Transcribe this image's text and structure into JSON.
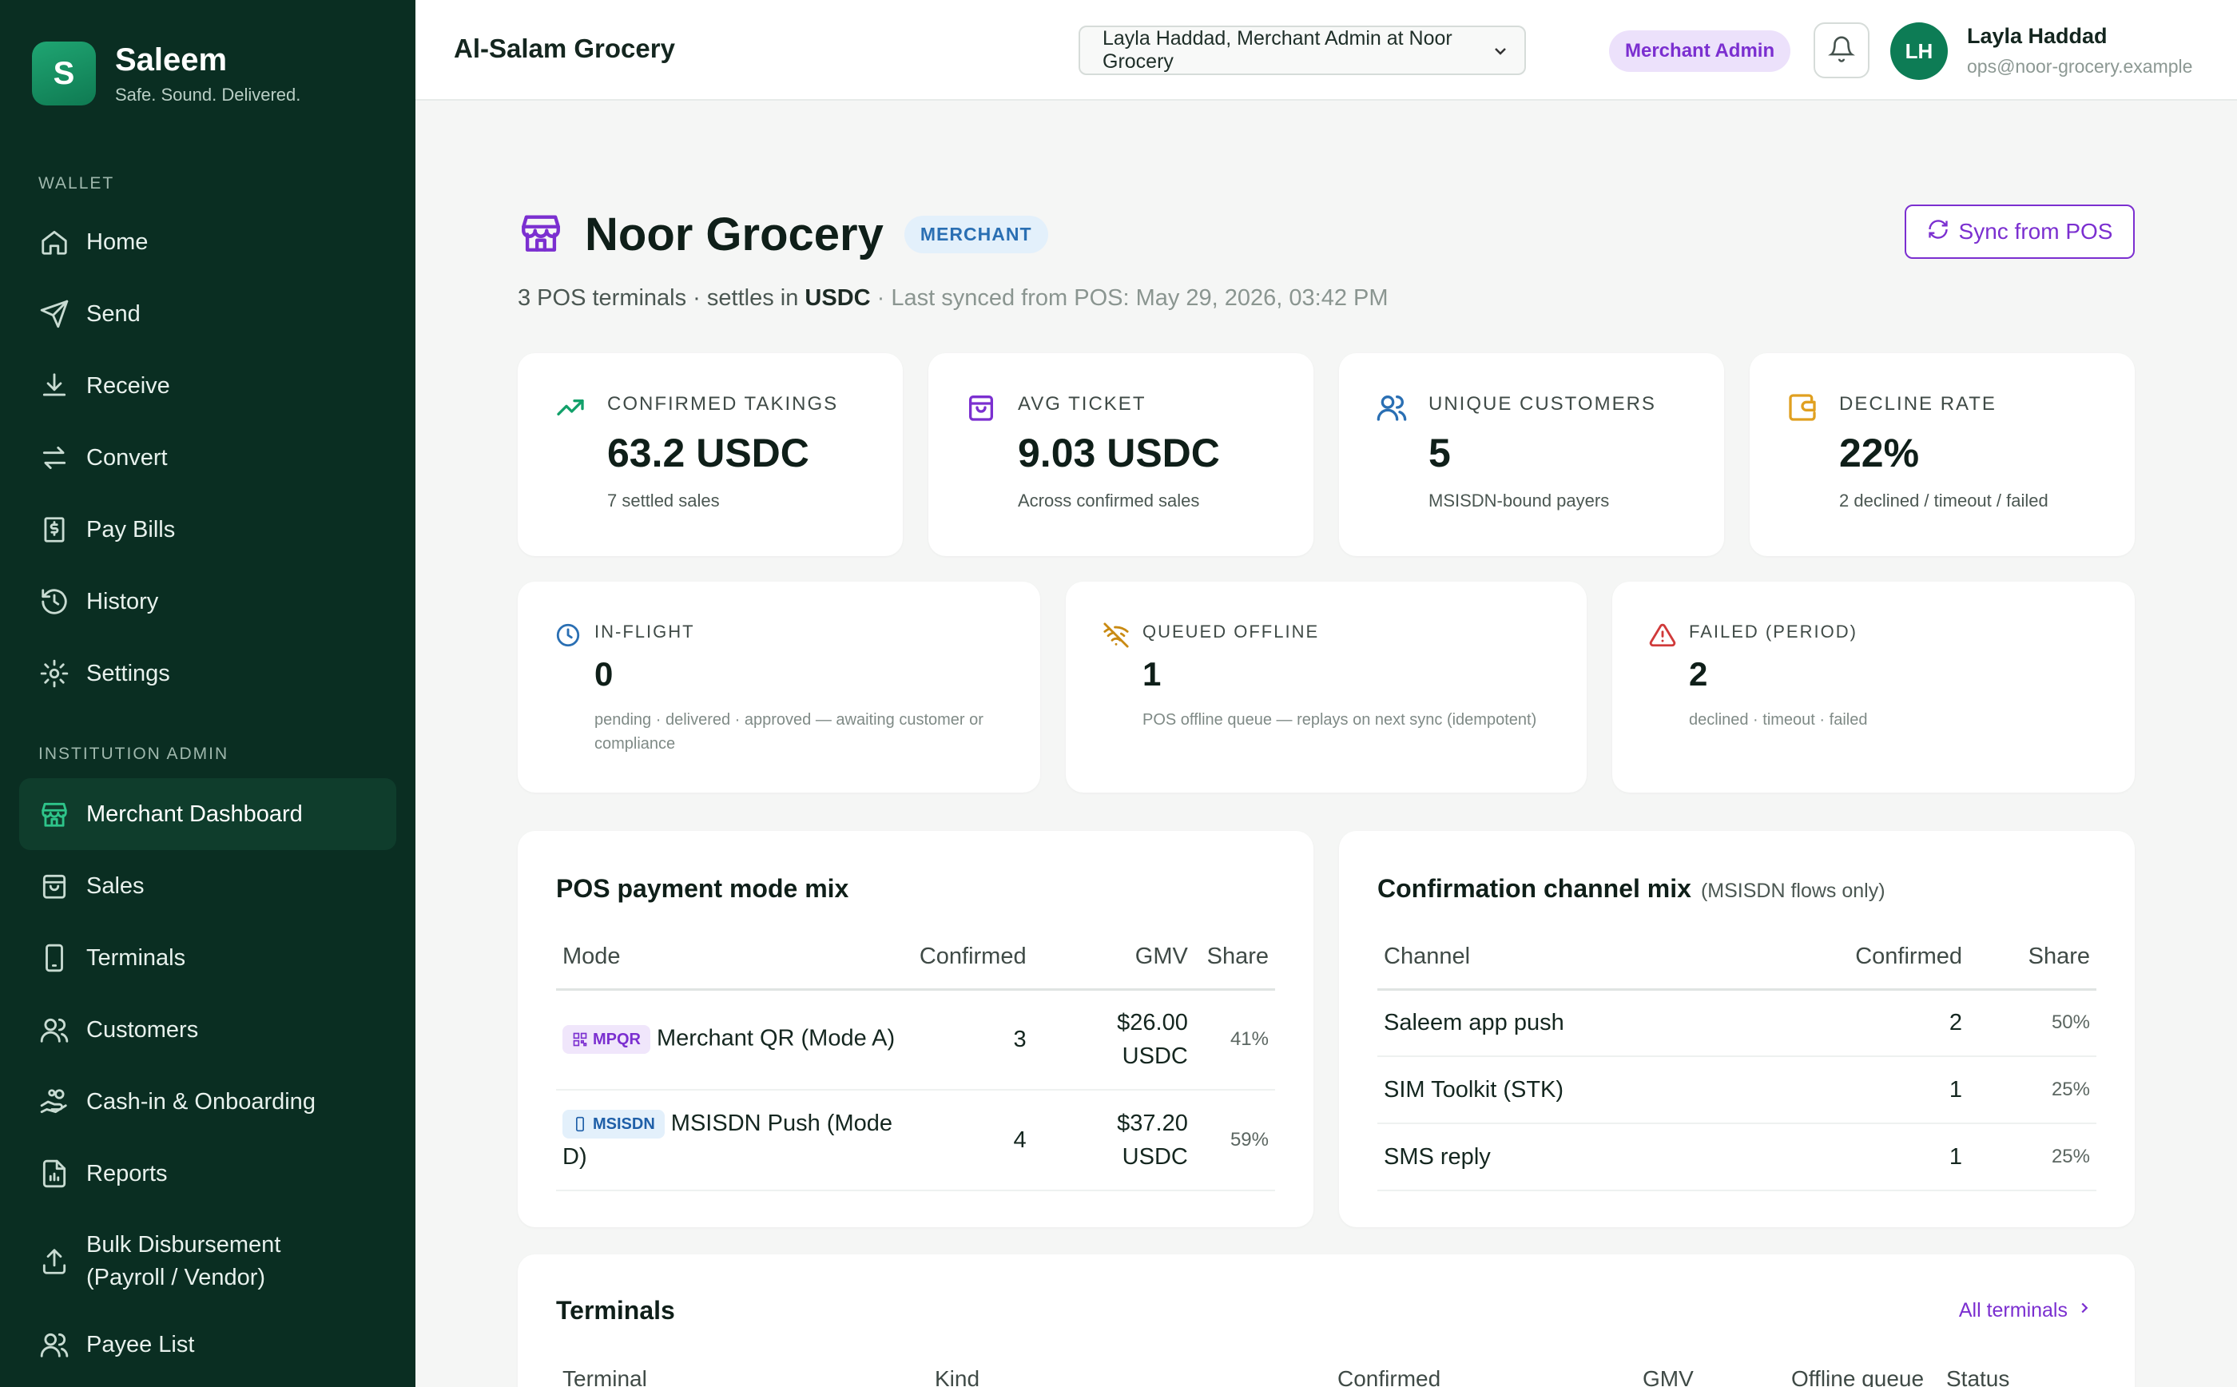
{
  "brand": {
    "initial": "S",
    "name": "Saleem",
    "tagline": "Safe. Sound. Delivered."
  },
  "sidebar": {
    "wallet_section": "WALLET",
    "wallet_items": [
      {
        "label": "Home",
        "icon": "home-icon"
      },
      {
        "label": "Send",
        "icon": "send-icon"
      },
      {
        "label": "Receive",
        "icon": "receive-icon"
      },
      {
        "label": "Convert",
        "icon": "convert-icon"
      },
      {
        "label": "Pay Bills",
        "icon": "bill-icon"
      },
      {
        "label": "History",
        "icon": "history-icon"
      },
      {
        "label": "Settings",
        "icon": "settings-icon"
      }
    ],
    "admin_section": "INSTITUTION ADMIN",
    "admin_items": [
      {
        "label": "Merchant Dashboard",
        "icon": "store-icon",
        "active": true
      },
      {
        "label": "Sales",
        "icon": "shopping-bag-icon"
      },
      {
        "label": "Terminals",
        "icon": "terminal-icon"
      },
      {
        "label": "Customers",
        "icon": "users-icon"
      },
      {
        "label": "Cash-in & Onboarding",
        "icon": "hand-coins-icon"
      },
      {
        "label": "Reports",
        "icon": "report-icon"
      },
      {
        "label": "Bulk Disbursement (Payroll / Vendor)",
        "icon": "upload-icon"
      },
      {
        "label": "Payee List",
        "icon": "payees-icon"
      }
    ]
  },
  "header": {
    "org_title": "Al-Salam Grocery",
    "role_select_value": "Layla Haddad, Merchant Admin at Noor Grocery",
    "role_pill": "Merchant Admin",
    "user_initials": "LH",
    "user_name": "Layla Haddad",
    "user_email": "ops@noor-grocery.example"
  },
  "page": {
    "title": "Noor Grocery",
    "badge": "MERCHANT",
    "sync_button": "Sync from POS",
    "sub_terminals": "3 POS terminals · settles in",
    "sub_currency": "USDC",
    "sub_synced": "· Last synced from POS: May 29, 2026, 03:42 PM"
  },
  "kpis": [
    {
      "label": "CONFIRMED TAKINGS",
      "value": "63.2 USDC",
      "sub": "7 settled sales",
      "icon": "trending-up-icon",
      "color": "#12a06a"
    },
    {
      "label": "AVG TICKET",
      "value": "9.03 USDC",
      "sub": "Across confirmed sales",
      "icon": "shopping-bag-icon",
      "color": "#7b2fd0"
    },
    {
      "label": "UNIQUE CUSTOMERS",
      "value": "5",
      "sub": "MSISDN-bound payers",
      "icon": "users-icon",
      "color": "#2a6fb3"
    },
    {
      "label": "DECLINE RATE",
      "value": "22%",
      "sub": "2 declined / timeout / failed",
      "icon": "wallet-icon",
      "color": "#e0a020"
    }
  ],
  "status_cards": [
    {
      "label": "IN-FLIGHT",
      "value": "0",
      "sub": "pending · delivered · approved — awaiting customer or compliance",
      "icon": "clock-icon",
      "color": "#2a6fb3"
    },
    {
      "label": "QUEUED OFFLINE",
      "value": "1",
      "sub": "POS offline queue — replays on next sync (idempotent)",
      "icon": "wifi-off-icon",
      "color": "#c98a12"
    },
    {
      "label": "FAILED (PERIOD)",
      "value": "2",
      "sub": "declined · timeout · failed",
      "icon": "alert-triangle-icon",
      "color": "#d03a3a"
    }
  ],
  "mode_mix": {
    "title": "POS payment mode mix",
    "headers": [
      "Mode",
      "Confirmed",
      "GMV",
      "Share"
    ],
    "rows": [
      {
        "tag": "MPQR",
        "mode": "Merchant QR (Mode A)",
        "confirmed": "3",
        "gmv": "$26.00 USDC",
        "share": "41%"
      },
      {
        "tag": "MSISDN",
        "mode": "MSISDN Push (Mode D)",
        "confirmed": "4",
        "gmv": "$37.20 USDC",
        "share": "59%"
      }
    ]
  },
  "channel_mix": {
    "title": "Confirmation channel mix",
    "note": "(MSISDN flows only)",
    "headers": [
      "Channel",
      "Confirmed",
      "Share"
    ],
    "rows": [
      {
        "channel": "Saleem app push",
        "confirmed": "2",
        "share": "50%"
      },
      {
        "channel": "SIM Toolkit (STK)",
        "confirmed": "1",
        "share": "25%"
      },
      {
        "channel": "SMS reply",
        "confirmed": "1",
        "share": "25%"
      }
    ]
  },
  "terminals": {
    "title": "Terminals",
    "all_link": "All terminals",
    "headers": [
      "Terminal",
      "Kind",
      "Confirmed",
      "GMV",
      "Offline queue",
      "Status"
    ]
  },
  "colors": {
    "sidebar_bg": "#0a2e22",
    "accent_green": "#12a06a",
    "accent_purple": "#7b2fd0"
  }
}
